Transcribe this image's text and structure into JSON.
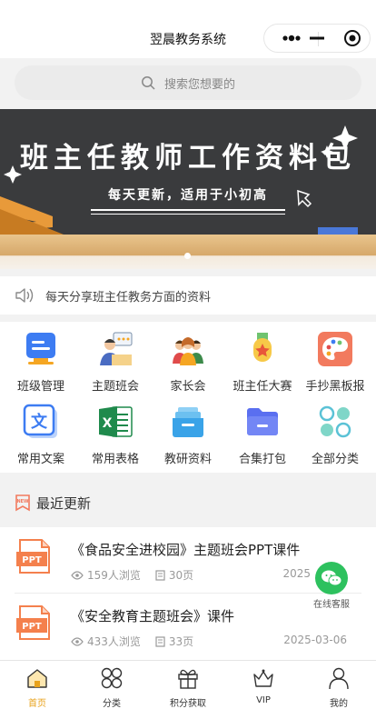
{
  "app": {
    "title": "翌晨教务系统"
  },
  "search": {
    "placeholder": "搜索您想要的"
  },
  "banner": {
    "title": "班主任教师工作资料包",
    "subtitle": "每天更新，适用于小初高"
  },
  "notice": {
    "text": "每天分享班主任教务方面的资料"
  },
  "categories": [
    {
      "label": "班级管理",
      "icon": "class-management-icon"
    },
    {
      "label": "主题班会",
      "icon": "class-meeting-icon"
    },
    {
      "label": "家长会",
      "icon": "parents-meeting-icon"
    },
    {
      "label": "班主任大赛",
      "icon": "contest-medal-icon"
    },
    {
      "label": "手抄黑板报",
      "icon": "palette-icon"
    },
    {
      "label": "常用文案",
      "icon": "document-text-icon"
    },
    {
      "label": "常用表格",
      "icon": "excel-icon"
    },
    {
      "label": "教研资料",
      "icon": "inbox-tray-icon"
    },
    {
      "label": "合集打包",
      "icon": "folder-icon"
    },
    {
      "label": "全部分类",
      "icon": "all-categories-icon"
    }
  ],
  "recent": {
    "title": "最近更新",
    "items": [
      {
        "title": "《食品安全进校园》主题班会PPT课件",
        "views": "159人浏览",
        "pages": "30页",
        "date": "2025"
      },
      {
        "title": "《安全教育主题班会》课件",
        "views": "433人浏览",
        "pages": "33页",
        "date": "2025-03-06"
      }
    ]
  },
  "support": {
    "label": "在线客服"
  },
  "tabs": [
    {
      "label": "首页",
      "active": true
    },
    {
      "label": "分类",
      "active": false
    },
    {
      "label": "积分获取",
      "active": false
    },
    {
      "label": "VIP",
      "active": false
    },
    {
      "label": "我的",
      "active": false
    }
  ],
  "colors": {
    "accent": "#e8a21b",
    "ppt": "#f4804d",
    "banner_bg": "#3a3b3d",
    "support": "#2dc15e"
  }
}
